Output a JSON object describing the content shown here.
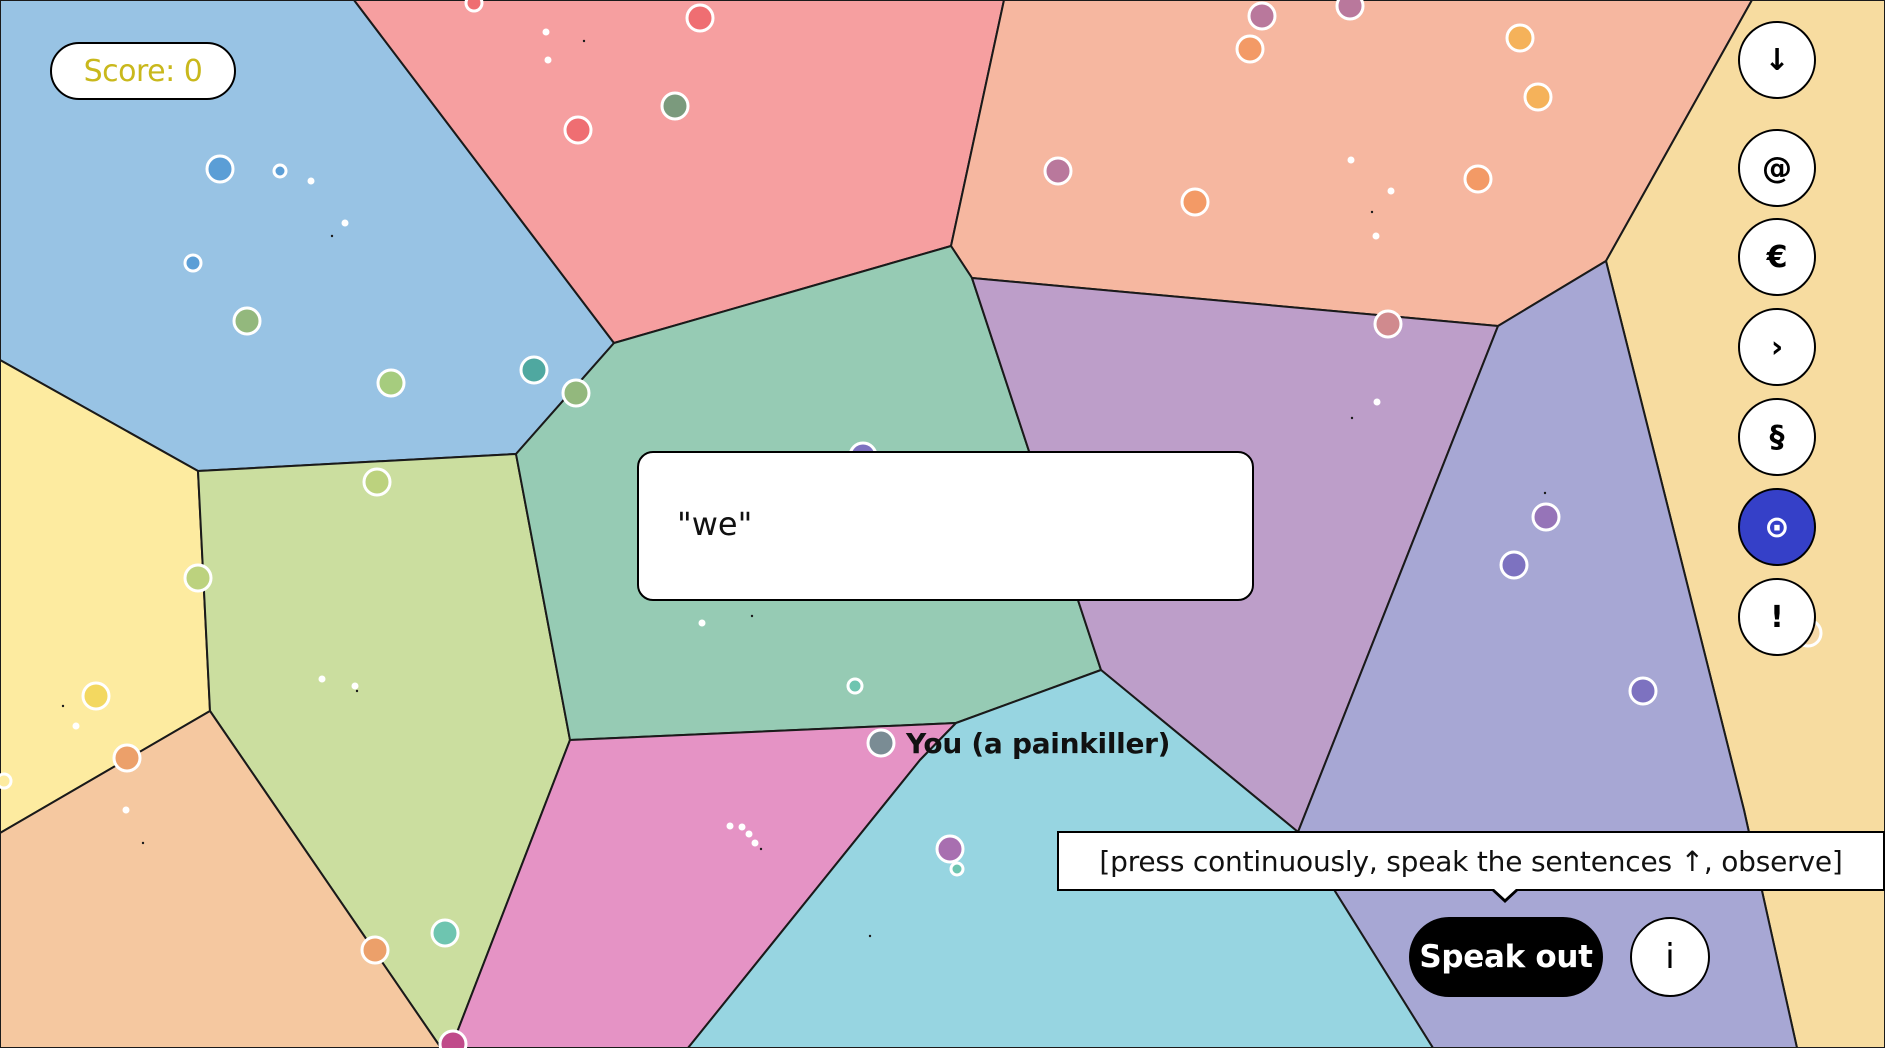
{
  "score": {
    "label": "Score: 0"
  },
  "prompt": {
    "word": "\"we\""
  },
  "player": {
    "label": "You (a painkiller)"
  },
  "toolbar": {
    "buttons": [
      {
        "symbol": "↓",
        "name": "down-arrow",
        "active": false
      },
      {
        "symbol": "@",
        "name": "at-sign",
        "active": false
      },
      {
        "symbol": "€",
        "name": "euro",
        "active": false
      },
      {
        "symbol": "›",
        "name": "chevron-right",
        "active": false
      },
      {
        "symbol": "§",
        "name": "section",
        "active": false
      },
      {
        "symbol": "⊙",
        "name": "target",
        "active": true
      },
      {
        "symbol": "!",
        "name": "exclamation",
        "active": false
      }
    ]
  },
  "hint": {
    "text": "[press continuously, speak the sentences ↑, observe]"
  },
  "actions": {
    "speak_label": "Speak out",
    "info_label": "i"
  },
  "colors": {
    "score_text": "#c9b81c",
    "active_button": "#3540c8",
    "regions": [
      "#98c3e4",
      "#f69fa0",
      "#f6b7a0",
      "#f7dca0",
      "#fdeba0",
      "#cbde9f",
      "#96cbb4",
      "#bd9ec9",
      "#a7a7d4",
      "#f5c8a0",
      "#e593c5",
      "#97d5e1"
    ]
  }
}
